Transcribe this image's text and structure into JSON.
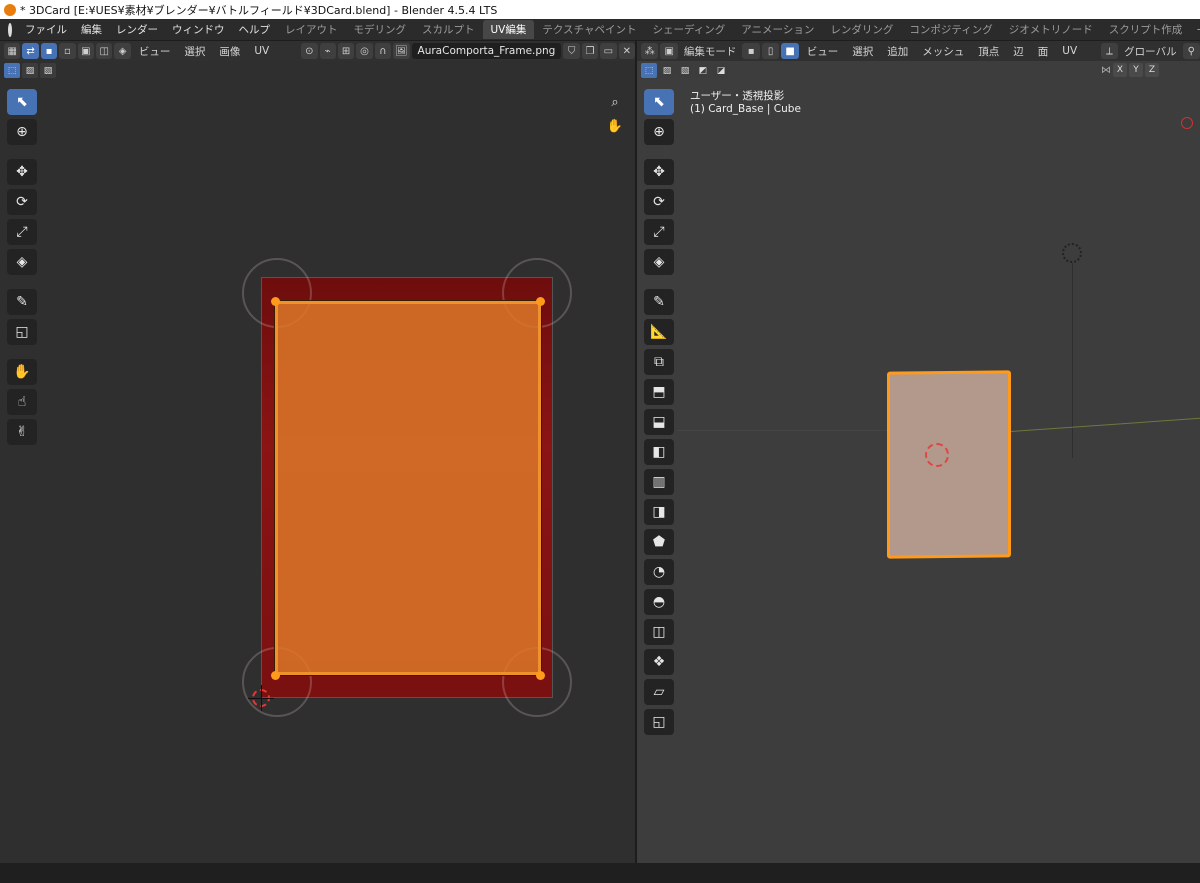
{
  "window": {
    "title": "* 3DCard [E:¥UES¥素材¥ブレンダー¥バトルフィールド¥3DCard.blend] - Blender 4.5.4 LTS"
  },
  "menu": [
    "ファイル",
    "編集",
    "レンダー",
    "ウィンドウ",
    "ヘルプ"
  ],
  "workspaces": [
    {
      "label": "レイアウト",
      "active": false
    },
    {
      "label": "モデリング",
      "active": false
    },
    {
      "label": "スカルプト",
      "active": false
    },
    {
      "label": "UV編集",
      "active": true
    },
    {
      "label": "テクスチャペイント",
      "active": false
    },
    {
      "label": "シェーディング",
      "active": false
    },
    {
      "label": "アニメーション",
      "active": false
    },
    {
      "label": "レンダリング",
      "active": false
    },
    {
      "label": "コンポジティング",
      "active": false
    },
    {
      "label": "ジオメトリノード",
      "active": false
    },
    {
      "label": "スクリプト作成",
      "active": false
    }
  ],
  "workspace_add": "+",
  "uv_editor": {
    "menus": [
      "ビュー",
      "選択",
      "画像",
      "UV"
    ],
    "image_name": "AuraComporta_Frame.png"
  },
  "view3d": {
    "mode": "編集モード",
    "menus": [
      "ビュー",
      "選択",
      "追加",
      "メッシュ",
      "頂点",
      "辺",
      "面",
      "UV"
    ],
    "orientation": "グローバル",
    "axes": [
      "X",
      "Y",
      "Z"
    ],
    "view_name": "ユーザー・透視投影",
    "object_info": "(1) Card_Base | Cube"
  },
  "colors": {
    "accent": "#4772b3",
    "selection": "#ff9a1a",
    "uv_face": "#dc7828",
    "frame_red": "#8b1414",
    "mesh_face": "#b3998c"
  }
}
